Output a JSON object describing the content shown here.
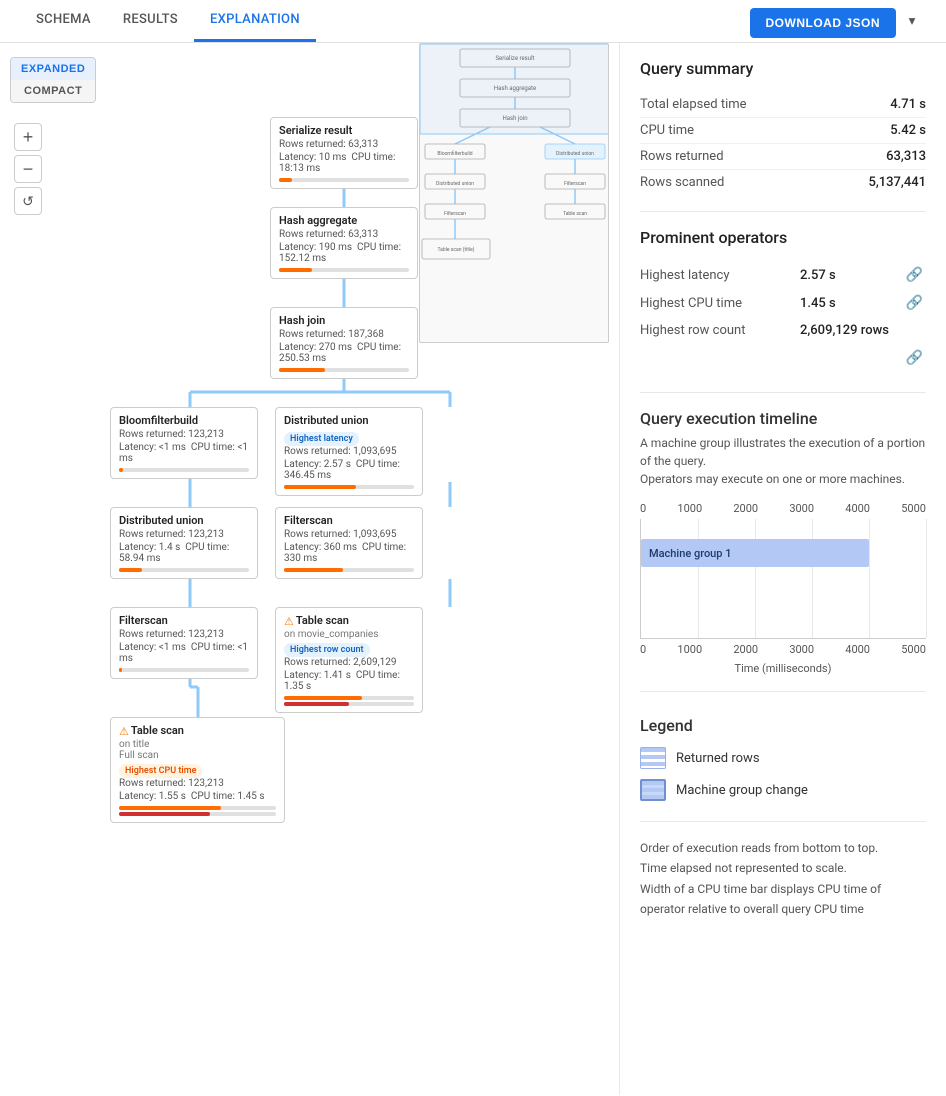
{
  "tabs": [
    {
      "label": "SCHEMA",
      "active": false
    },
    {
      "label": "RESULTS",
      "active": false
    },
    {
      "label": "EXPLANATION",
      "active": true
    }
  ],
  "view_toggle": {
    "expanded_label": "EXPANDED",
    "compact_label": "COMPACT"
  },
  "download_button": "DOWNLOAD JSON",
  "nodes": {
    "serialize": {
      "title": "Serialize result",
      "rows": "Rows returned: 63,313",
      "latency": "Latency: 10 ms",
      "cpu": "CPU time: 18:13 ms"
    },
    "hash_agg": {
      "title": "Hash aggregate",
      "rows": "Rows returned: 63,313",
      "latency": "Latency: 190 ms",
      "cpu": "CPU time: 152.12 ms"
    },
    "hash_join": {
      "title": "Hash join",
      "rows": "Rows returned: 187,368",
      "latency": "Latency: 270 ms",
      "cpu": "CPU time: 250.53 ms"
    },
    "bloomfilter": {
      "title": "Bloomfilterbuild",
      "rows": "Rows returned: 123,213",
      "latency": "Latency: <1 ms",
      "cpu": "CPU time: <1 ms"
    },
    "dist_union_r": {
      "title": "Distributed union",
      "rows": "Rows returned: 1,093,695",
      "latency": "Latency: 2.57 s",
      "cpu": "CPU time: 346.45 ms",
      "badge": "Highest latency",
      "badge_type": "blue"
    },
    "dist_union_l": {
      "title": "Distributed union",
      "rows": "Rows returned: 123,213",
      "latency": "Latency: 1.4 s",
      "cpu": "CPU time: 58.94 ms"
    },
    "filterscan_r": {
      "title": "Filterscan",
      "rows": "Rows returned: 1,093,695",
      "latency": "Latency: 360 ms",
      "cpu": "CPU time: 330 ms"
    },
    "filterscan_l": {
      "title": "Filterscan",
      "rows": "Rows returned: 123,213",
      "latency": "Latency: <1 ms",
      "cpu": "CPU time: <1 ms"
    },
    "table_scan_r": {
      "title": "Table scan",
      "subtitle": "on movie_companies",
      "rows": "Rows returned: 2,609,129",
      "latency": "Latency: 1.41 s",
      "cpu": "CPU time: 1.35 s",
      "badge": "Highest row count",
      "badge_type": "blue",
      "warn": true
    },
    "table_scan_l": {
      "title": "Table scan",
      "subtitle": "on title",
      "sub2": "Full scan",
      "rows": "Rows returned: 123,213",
      "latency": "Latency: 1.55 s",
      "cpu": "CPU time: 1.45 s",
      "badge": "Highest CPU time",
      "badge_type": "orange",
      "warn": true
    }
  },
  "query_summary": {
    "title": "Query summary",
    "rows": [
      {
        "label": "Total elapsed time",
        "value": "4.71 s"
      },
      {
        "label": "CPU time",
        "value": "5.42 s"
      },
      {
        "label": "Rows returned",
        "value": "63,313"
      },
      {
        "label": "Rows scanned",
        "value": "5,137,441"
      }
    ]
  },
  "prominent_operators": {
    "title": "Prominent operators",
    "rows": [
      {
        "label": "Highest latency",
        "value": "2.57 s"
      },
      {
        "label": "Highest CPU time",
        "value": "1.45 s"
      },
      {
        "label": "Highest row count",
        "value": "2,609,129 rows"
      }
    ]
  },
  "timeline": {
    "title": "Query execution timeline",
    "desc1": "A machine group illustrates the execution of a portion of the query.",
    "desc2": "Operators may execute on one or more machines.",
    "x_axis": [
      "0",
      "1000",
      "2000",
      "3000",
      "4000",
      "5000"
    ],
    "machine_group": "Machine group 1",
    "bar_start_pct": 0,
    "bar_width_pct": 80,
    "x_label": "Time (milliseconds)"
  },
  "legend": {
    "title": "Legend",
    "items": [
      {
        "label": "Returned rows",
        "type": "returned"
      },
      {
        "label": "Machine group change",
        "type": "machine"
      }
    ]
  },
  "notes": [
    "Order of execution reads from bottom to top.",
    "Time elapsed not represented to scale.",
    "Width of a CPU time bar displays CPU time of operator relative to overall query CPU time"
  ]
}
